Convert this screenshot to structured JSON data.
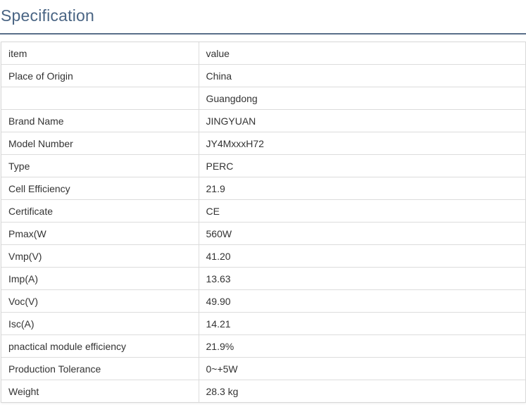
{
  "heading": "Specification",
  "table": {
    "header": {
      "item": "item",
      "value": "value"
    },
    "rows": [
      {
        "item": "Place of Origin",
        "value": "China"
      },
      {
        "item": "",
        "value": "Guangdong"
      },
      {
        "item": "Brand Name",
        "value": "JINGYUAN"
      },
      {
        "item": "Model Number",
        "value": "JY4MxxxH72"
      },
      {
        "item": "Type",
        "value": "PERC"
      },
      {
        "item": "Cell Efficiency",
        "value": "21.9"
      },
      {
        "item": "Certificate",
        "value": "CE"
      },
      {
        "item": "Pmax(W",
        "value": "560W"
      },
      {
        "item": "Vmp(V)",
        "value": "41.20"
      },
      {
        "item": "Imp(A)",
        "value": "13.63"
      },
      {
        "item": "Voc(V)",
        "value": "49.90"
      },
      {
        "item": "Isc(A)",
        "value": "14.21"
      },
      {
        "item": "pnactical module efficiency",
        "value": "21.9%"
      },
      {
        "item": "Production Tolerance",
        "value": "0~+5W"
      },
      {
        "item": "Weight",
        "value": "28.3 kg"
      }
    ]
  }
}
